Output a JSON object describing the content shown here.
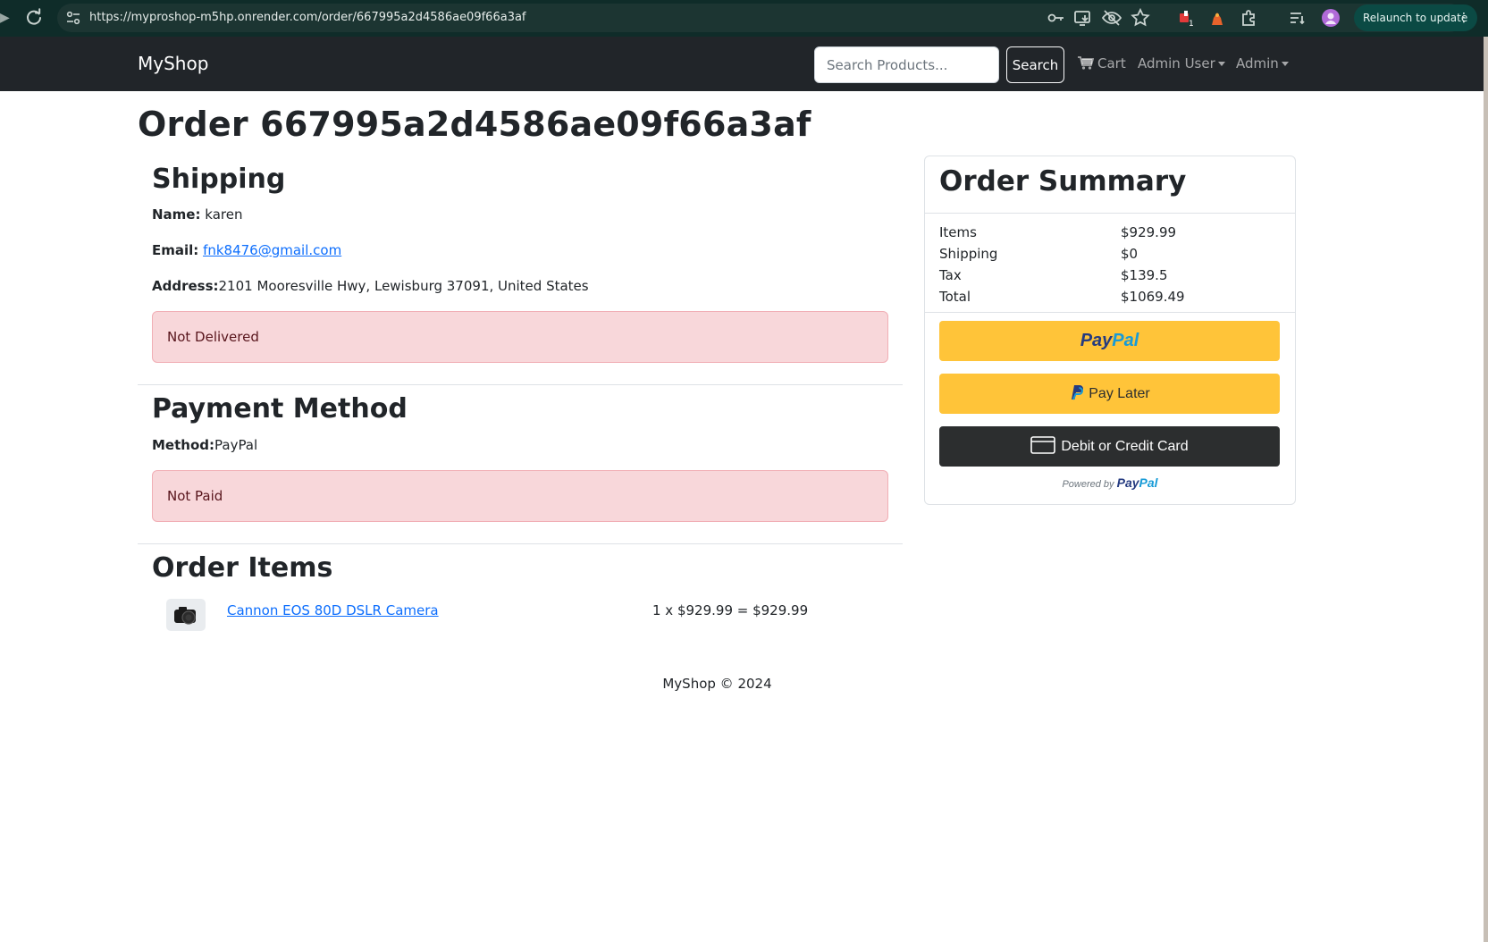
{
  "browser": {
    "url": "https://myproshop-m5hp.onrender.com/order/667995a2d4586ae09f66a3af",
    "relaunch_label": "Relaunch to update",
    "extension_badge": "1"
  },
  "navbar": {
    "brand": "MyShop",
    "search_placeholder": "Search Products...",
    "search_button": "Search",
    "cart_label": "Cart",
    "user_menu": "Admin User",
    "admin_menu": "Admin"
  },
  "order": {
    "title": "Order 667995a2d4586ae09f66a3af",
    "shipping": {
      "heading": "Shipping",
      "name_label": "Name:",
      "name_value": "karen",
      "email_label": "Email:",
      "email_value": "fnk8476@gmail.com",
      "address_label": "Address:",
      "address_value": "2101 Mooresville Hwy, Lewisburg 37091, United States",
      "status": "Not Delivered"
    },
    "payment": {
      "heading": "Payment Method",
      "method_label": "Method:",
      "method_value": "PayPal",
      "status": "Not Paid"
    },
    "items": {
      "heading": "Order Items",
      "list": [
        {
          "name": "Cannon EOS 80D DSLR Camera",
          "calc": "1 x $929.99 = $929.99"
        }
      ]
    }
  },
  "summary": {
    "heading": "Order Summary",
    "rows": [
      {
        "label": "Items",
        "value": "$929.99"
      },
      {
        "label": "Shipping",
        "value": "$0"
      },
      {
        "label": "Tax",
        "value": "$139.5"
      },
      {
        "label": "Total",
        "value": "$1069.49"
      }
    ],
    "paypal_logo_part1": "Pay",
    "paypal_logo_part2": "Pal",
    "pay_later_label": "Pay Later",
    "card_label": "Debit or Credit Card",
    "powered_by": "Powered by"
  },
  "footer": {
    "text": "MyShop © 2024"
  },
  "colors": {
    "navbar_bg": "#212529",
    "alert_bg": "#f8d7da",
    "alert_text": "#58151c",
    "link": "#0d6efd",
    "paypal_gold": "#ffc439",
    "paypal_dark": "#2c2e2f"
  }
}
